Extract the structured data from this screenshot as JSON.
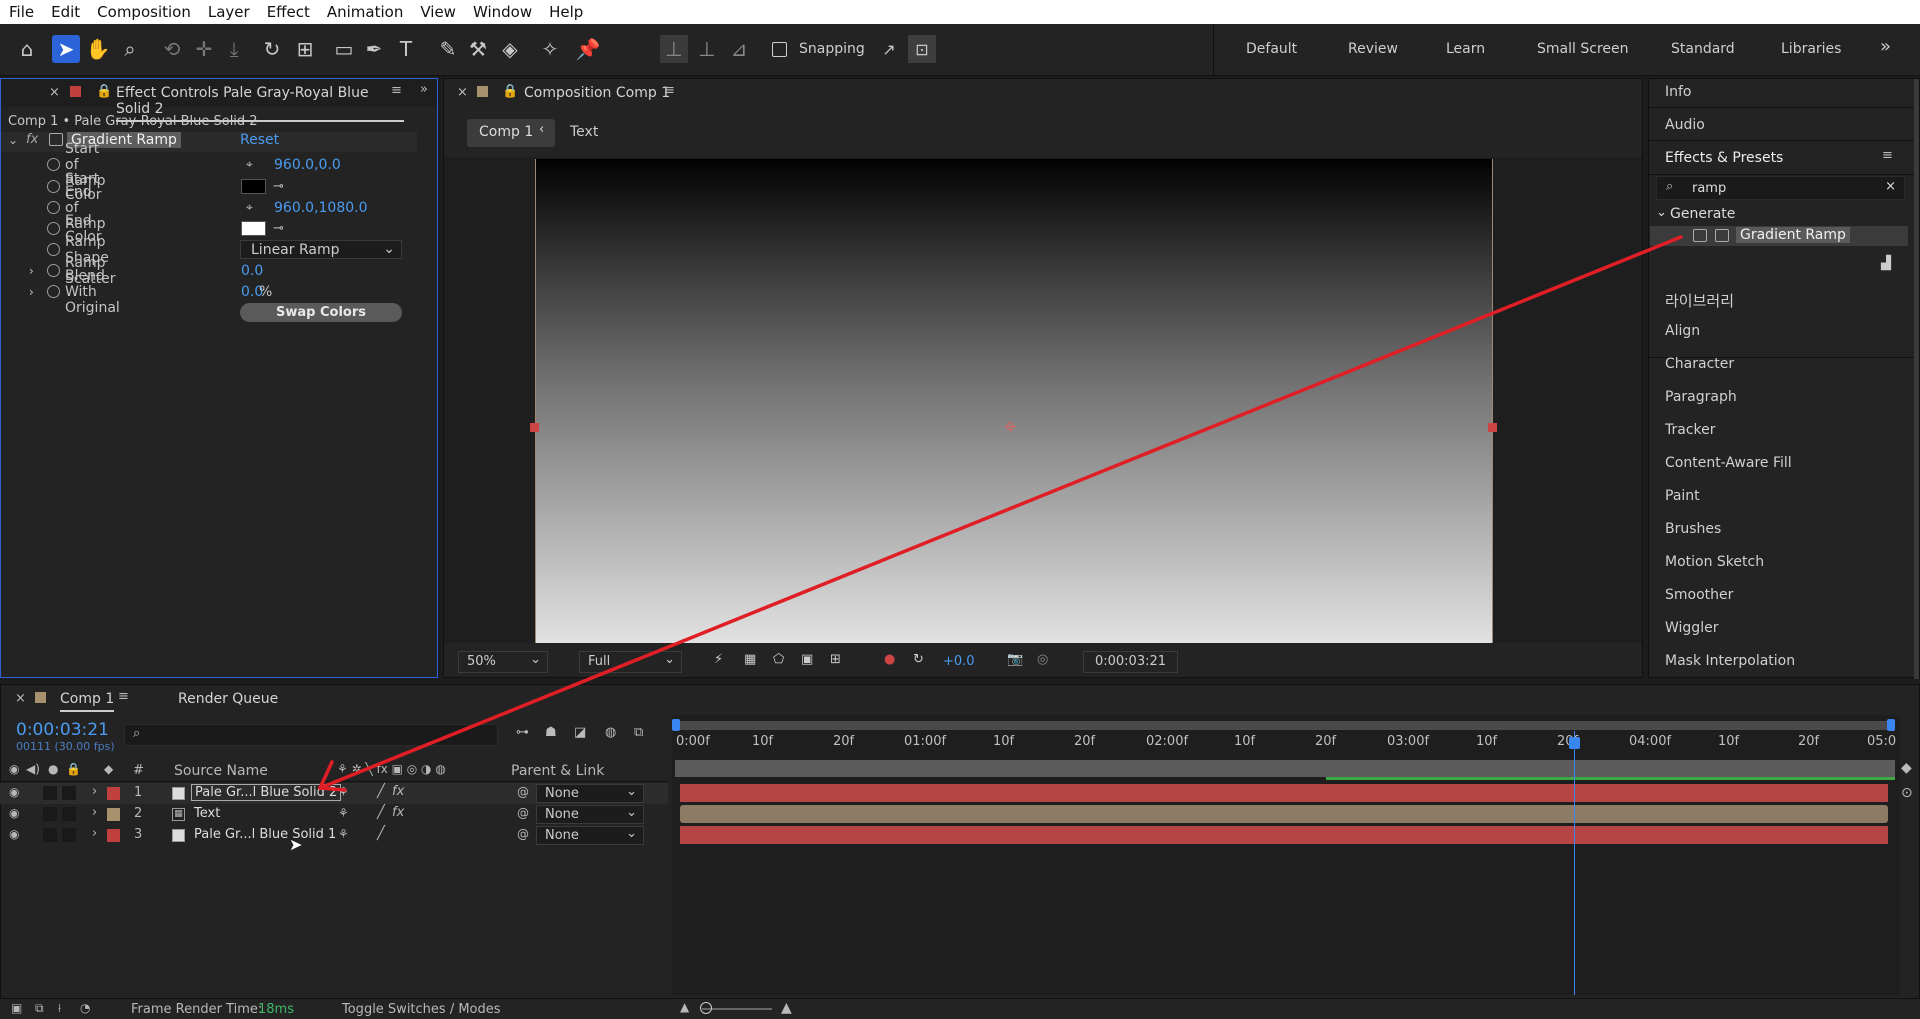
{
  "menu": [
    "File",
    "Edit",
    "Composition",
    "Layer",
    "Effect",
    "Animation",
    "View",
    "Window",
    "Help"
  ],
  "toolbar": {
    "snapping": "Snapping",
    "workspaces": [
      "Default",
      "Review",
      "Learn",
      "Small Screen",
      "Standard",
      "Libraries"
    ],
    "more": "»"
  },
  "effect_controls": {
    "tab": "Effect Controls Pale Gray-Royal Blue Solid 2",
    "subtitle": "Comp 1 • Pale Gray-Royal Blue Solid 2",
    "effect_name": "Gradient Ramp",
    "reset": "Reset",
    "props": [
      {
        "label": "Start of Ramp",
        "value": "960.0,0.0"
      },
      {
        "label": "Start Color",
        "value": ""
      },
      {
        "label": "End of Ramp",
        "value": "960.0,1080.0"
      },
      {
        "label": "End Color",
        "value": ""
      },
      {
        "label": "Ramp Shape",
        "value": "Linear Ramp"
      },
      {
        "label": "Ramp Scatter",
        "value": "0.0"
      },
      {
        "label": "Blend With Original",
        "value": "0.0",
        "unit": "%"
      }
    ],
    "swap": "Swap Colors"
  },
  "composition": {
    "tab": "Composition Comp 1",
    "breadcrumb": [
      "Comp 1",
      "Text"
    ],
    "zoom": "50%",
    "quality": "Full",
    "exposure": "+0.0",
    "timecode": "0:00:03:21"
  },
  "right_panel": {
    "items_top": [
      "Info",
      "Audio"
    ],
    "effects_presets": "Effects & Presets",
    "search": "ramp",
    "category": "Generate",
    "result": "Gradient Ramp",
    "items": [
      "라이브러리",
      "Align",
      "Character",
      "Paragraph",
      "Tracker",
      "Content-Aware Fill",
      "Paint",
      "Brushes",
      "Motion Sketch",
      "Smoother",
      "Wiggler",
      "Mask Interpolation"
    ]
  },
  "timeline": {
    "tab": "Comp 1",
    "render_queue": "Render Queue",
    "timecode": "0:00:03:21",
    "frames": "00111 (30.00 fps)",
    "col_num": "#",
    "col_source": "Source Name",
    "col_parent": "Parent & Link",
    "ruler": [
      "0:00f",
      "10f",
      "20f",
      "01:00f",
      "10f",
      "20f",
      "02:00f",
      "10f",
      "20f",
      "03:00f",
      "10f",
      "20f",
      "04:00f",
      "10f",
      "20f",
      "05:0"
    ],
    "layers": [
      {
        "num": "1",
        "name": "Pale Gr...l Blue Solid 2",
        "parent": "None"
      },
      {
        "num": "2",
        "name": "Text",
        "parent": "None"
      },
      {
        "num": "3",
        "name": "Pale Gr...l Blue Solid 1",
        "parent": "None"
      }
    ],
    "render_label": "Frame Render Time:",
    "render_value": "18ms",
    "toggle": "Toggle Switches / Modes"
  },
  "colors": {
    "accent": "#2d63d8",
    "layer_red": "#b54444",
    "layer_tan": "#8c7b65",
    "annotation": "#e01e26"
  }
}
